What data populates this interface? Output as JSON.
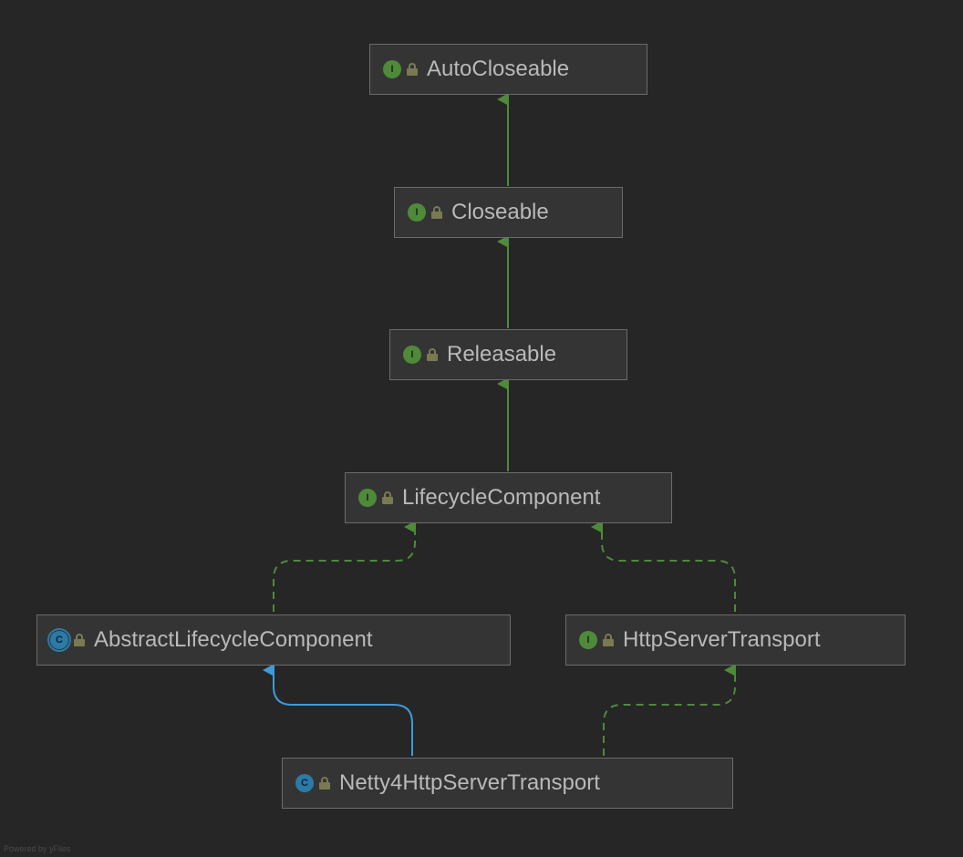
{
  "diagram": {
    "attribution": "Powered by yFiles",
    "colors": {
      "background": "#262626",
      "node_fill": "#343434",
      "node_border": "#6b6b6b",
      "label": "#b9b9b9",
      "interface_badge": "#4e8a3a",
      "class_badge": "#2b7aa8",
      "extends_edge": "#3e9bda",
      "implements_edge": "#4e8a3a"
    },
    "nodes": {
      "autocloseable": {
        "label": "AutoCloseable",
        "kind": "interface",
        "abstract": false,
        "badge_letter": "I"
      },
      "closeable": {
        "label": "Closeable",
        "kind": "interface",
        "abstract": false,
        "badge_letter": "I"
      },
      "releasable": {
        "label": "Releasable",
        "kind": "interface",
        "abstract": false,
        "badge_letter": "I"
      },
      "lifecycle": {
        "label": "LifecycleComponent",
        "kind": "interface",
        "abstract": false,
        "badge_letter": "I"
      },
      "abstractlc": {
        "label": "AbstractLifecycleComponent",
        "kind": "class",
        "abstract": true,
        "badge_letter": "C"
      },
      "httpserver": {
        "label": "HttpServerTransport",
        "kind": "interface",
        "abstract": false,
        "badge_letter": "I"
      },
      "netty4": {
        "label": "Netty4HttpServerTransport",
        "kind": "class",
        "abstract": false,
        "badge_letter": "C"
      }
    },
    "edges": [
      {
        "from": "closeable",
        "to": "autocloseable",
        "type": "implements",
        "style": "solid"
      },
      {
        "from": "releasable",
        "to": "closeable",
        "type": "implements",
        "style": "solid"
      },
      {
        "from": "lifecycle",
        "to": "releasable",
        "type": "implements",
        "style": "solid"
      },
      {
        "from": "abstractlc",
        "to": "lifecycle",
        "type": "implements",
        "style": "dashed"
      },
      {
        "from": "httpserver",
        "to": "lifecycle",
        "type": "implements",
        "style": "dashed"
      },
      {
        "from": "netty4",
        "to": "abstractlc",
        "type": "extends",
        "style": "solid"
      },
      {
        "from": "netty4",
        "to": "httpserver",
        "type": "implements",
        "style": "dashed"
      }
    ]
  }
}
